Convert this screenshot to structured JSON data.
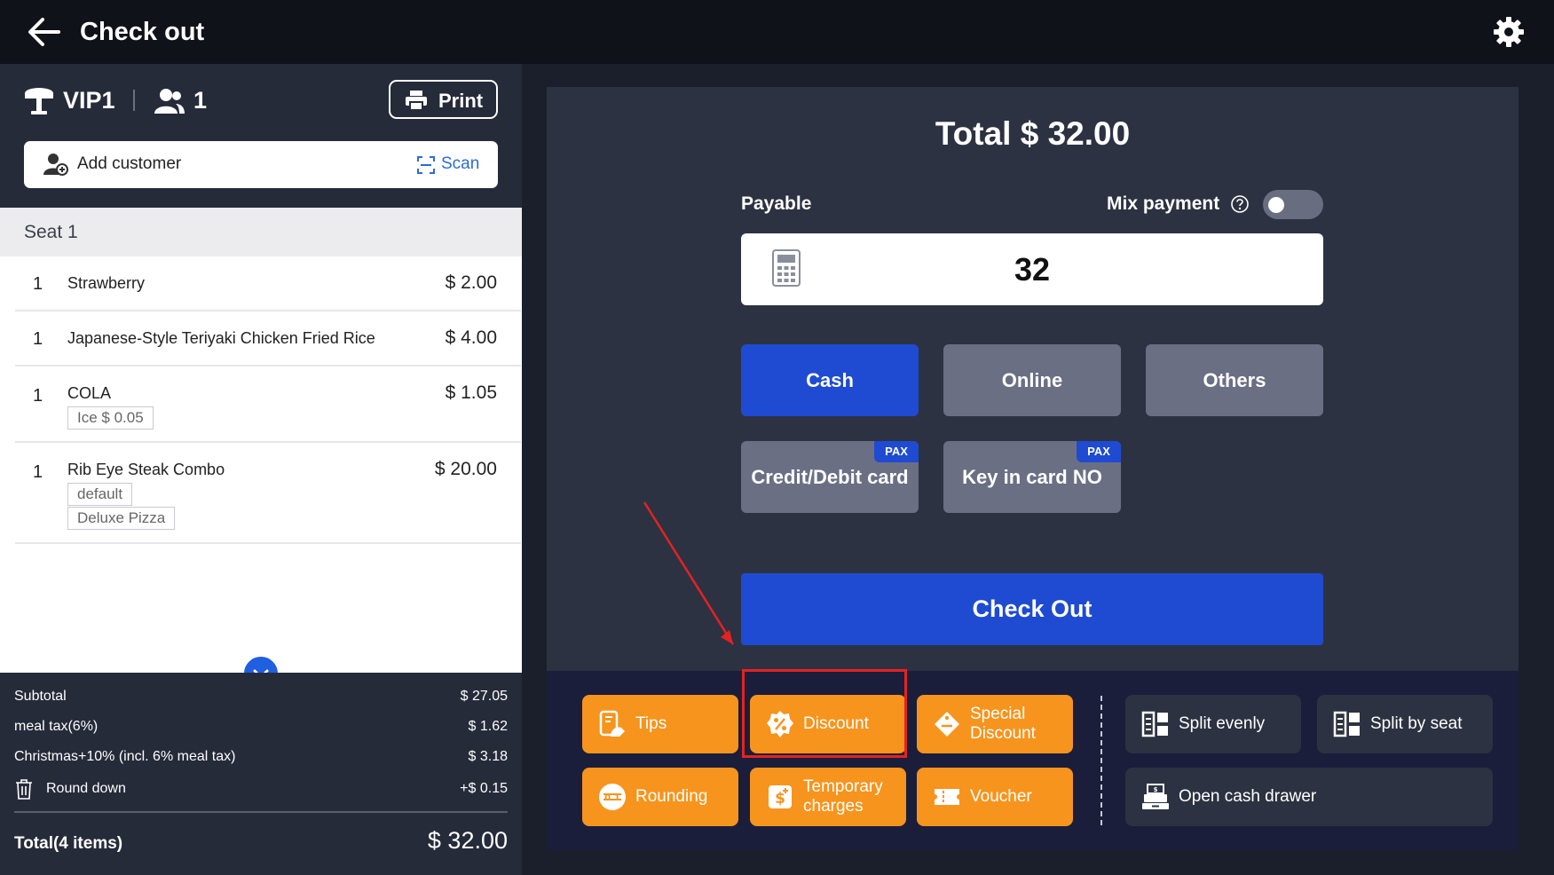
{
  "header": {
    "title": "Check out"
  },
  "order": {
    "table": "VIP1",
    "guests": "1",
    "print_label": "Print",
    "add_customer_label": "Add customer",
    "scan_label": "Scan",
    "seat_label": "Seat 1",
    "items": [
      {
        "qty": "1",
        "name": "Strawberry",
        "price": "$ 2.00",
        "modifiers": []
      },
      {
        "qty": "1",
        "name": "Japanese-Style Teriyaki Chicken Fried Rice",
        "price": "$ 4.00",
        "modifiers": []
      },
      {
        "qty": "1",
        "name": "COLA",
        "price": "$ 1.05",
        "modifiers": [
          "Ice  $ 0.05"
        ]
      },
      {
        "qty": "1",
        "name": "Rib Eye Steak Combo",
        "price": "$ 20.00",
        "modifiers": [
          "default",
          "Deluxe Pizza"
        ]
      }
    ]
  },
  "totals": {
    "subtotal_label": "Subtotal",
    "subtotal_value": "$ 27.05",
    "tax_label": "meal tax(6%)",
    "tax_value": "$ 1.62",
    "service_label": "Christmas+10% (incl. 6% meal tax)",
    "service_value": "$ 3.18",
    "rounding_label": "Round down",
    "rounding_value": "+$ 0.15",
    "grand_label": "Total(4 items)",
    "grand_value": "$ 32.00"
  },
  "payment": {
    "total_title": "Total $ 32.00",
    "payable_label": "Payable",
    "mix_payment_label": "Mix payment",
    "mix_payment_on": false,
    "amount": "32",
    "methods": [
      "Cash",
      "Online",
      "Others"
    ],
    "active_method": "Cash",
    "card_methods": [
      "Credit/Debit card",
      "Key in card NO"
    ],
    "card_badge": "PAX",
    "checkout_label": "Check Out"
  },
  "actions": {
    "tips": "Tips",
    "discount": "Discount",
    "special_discount": "Special Discount",
    "rounding": "Rounding",
    "temporary_charges": "Temporary charges",
    "voucher": "Voucher",
    "split_evenly": "Split evenly",
    "split_by_seat": "Split by seat",
    "open_cash_drawer": "Open cash drawer"
  },
  "colors": {
    "header_bg": "#0f1219",
    "panel_bg": "#2d3242",
    "primary_blue": "#1e4bd1",
    "action_orange": "#f7941d",
    "highlight_red": "#e52222"
  }
}
